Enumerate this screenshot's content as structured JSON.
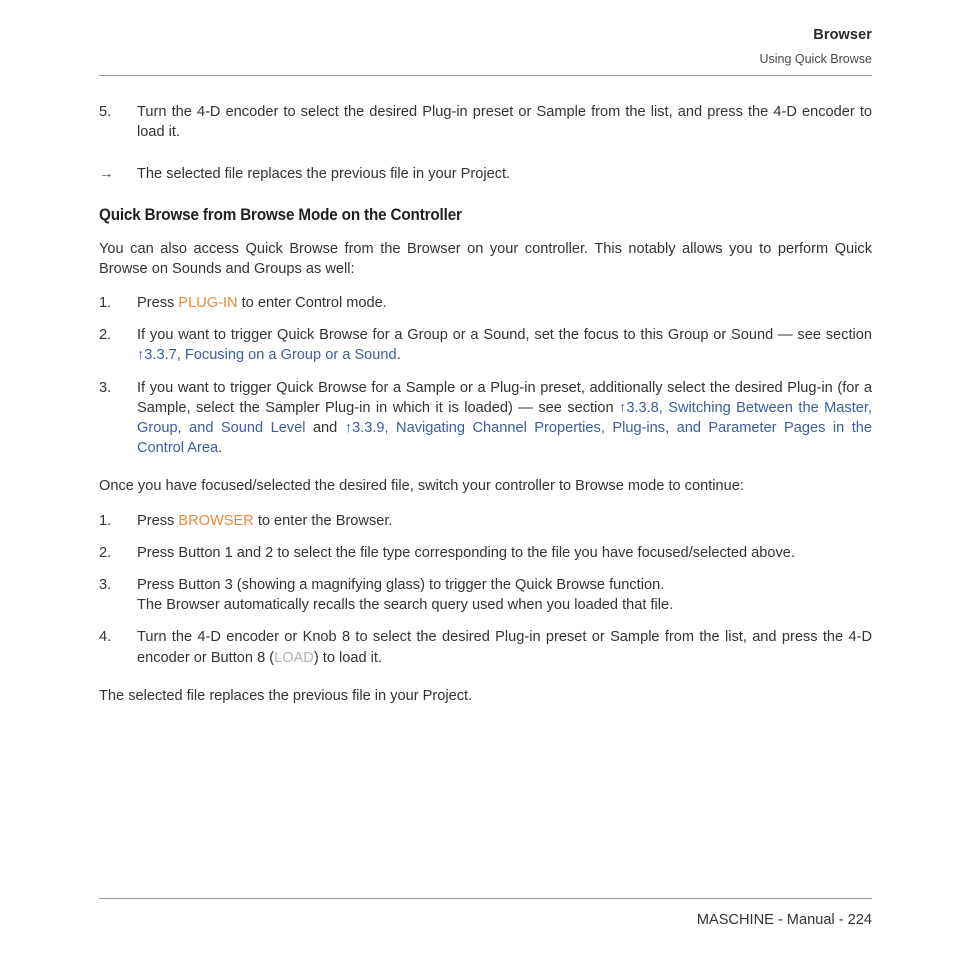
{
  "header": {
    "title": "Browser",
    "subtitle": "Using Quick Browse"
  },
  "content": {
    "item5": {
      "marker": "5.",
      "text_a": "Turn the 4-D encoder to select the desired Plug-in preset or Sample from the list, and press the 4-D encoder to load it."
    },
    "arrow_item": {
      "marker": "→",
      "text": "The selected file replaces the previous file in your Project."
    },
    "heading": "Quick Browse from Browse Mode on the Controller",
    "intro_para": "You can also access Quick Browse from the Browser on your controller. This notably allows you to perform Quick Browse on Sounds and Groups as well:",
    "list_a": [
      {
        "marker": "1.",
        "pre": "Press ",
        "hw": "PLUG-IN",
        "post": " to enter Control mode."
      },
      {
        "marker": "2.",
        "pre": "If you want to trigger Quick Browse for a Group or a Sound, set the focus to this Group or Sound — see section ",
        "link": "↑3.3.7, Focusing on a Group or a Sound",
        "post": "."
      },
      {
        "marker": "3.",
        "pre": "If you want to trigger Quick Browse for a Sample or a Plug-in preset, additionally select the desired Plug-in (for a Sample, select the Sampler Plug-in in which it is loaded) — see section ",
        "link": "↑3.3.8, Switching Between the Master, Group, and Sound Level",
        "mid": " and ",
        "link2": "↑3.3.9, Navigating Channel Properties, Plug-ins, and Parameter Pages in the Control Area",
        "post": "."
      }
    ],
    "mid_para": "Once you have focused/selected the desired file, switch your controller to Browse mode to continue:",
    "list_b": [
      {
        "marker": "1.",
        "pre": "Press ",
        "hw": "BROWSER",
        "post": " to enter the Browser."
      },
      {
        "marker": "2.",
        "text": "Press Button 1 and 2 to select the file type corresponding to the file you have focused/selected above."
      },
      {
        "marker": "3.",
        "line1": "Press Button 3 (showing a magnifying glass) to trigger the Quick Browse function.",
        "line2": "The Browser automatically recalls the search query used when you loaded that file."
      },
      {
        "marker": "4.",
        "pre": "Turn the 4-D encoder or Knob 8 to select the desired Plug-in preset or Sample from the list, and press the 4-D encoder or Button 8 (",
        "dim": "LOAD",
        "post": ") to load it."
      }
    ],
    "closing_para": "The selected file replaces the previous file in your Project."
  },
  "footer": {
    "text": "MASCHINE - Manual - 224"
  },
  "colors": {
    "hardware_label": "#E8893A",
    "cross_reference_link": "#3B5E9E",
    "dimmed_label": "#B2B2B2",
    "body_text": "#333333",
    "rule": "#9A9A9A"
  }
}
